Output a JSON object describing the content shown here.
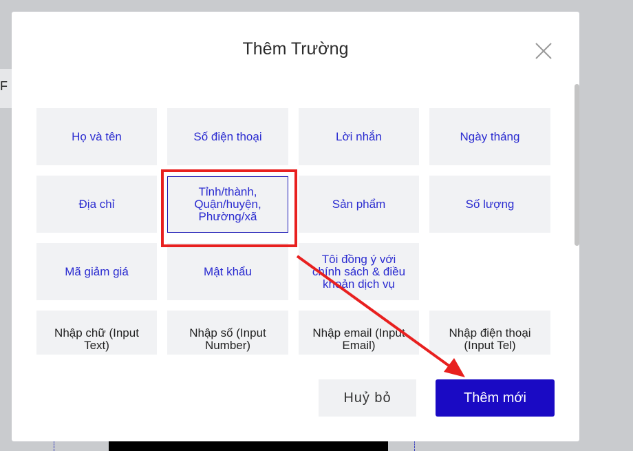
{
  "background": {
    "tab_glyph": "F"
  },
  "modal": {
    "title": "Thêm Trường",
    "close_icon": "close-icon"
  },
  "fields": [
    {
      "label": "Họ và tên",
      "type": "preset"
    },
    {
      "label": "Số điện thoại",
      "type": "preset"
    },
    {
      "label": "Lời nhắn",
      "type": "preset"
    },
    {
      "label": "Ngày tháng",
      "type": "preset"
    },
    {
      "label": "Địa chỉ",
      "type": "preset"
    },
    {
      "label": "Tỉnh/thành, Quận/huyện, Phường/xã",
      "type": "preset",
      "selected": true
    },
    {
      "label": "Sản phẩm",
      "type": "preset"
    },
    {
      "label": "Số lượng",
      "type": "preset"
    },
    {
      "label": "Mã giảm giá",
      "type": "preset"
    },
    {
      "label": "Mật khẩu",
      "type": "preset"
    },
    {
      "label": "Tôi đồng ý với chính sách & điều khoản dịch vụ",
      "type": "preset"
    },
    {
      "label": "Nhập chữ (Input Text)",
      "type": "input"
    },
    {
      "label": "Nhập số (Input Number)",
      "type": "input"
    },
    {
      "label": "Nhập email (Input Email)",
      "type": "input"
    },
    {
      "label": "Nhập điện thoại (Input Tel)",
      "type": "input"
    }
  ],
  "buttons": {
    "cancel": "Huỷ bỏ",
    "add": "Thêm mới"
  },
  "colors": {
    "accent": "#1a0ac4",
    "field_text": "#2a2bd0",
    "annotation": "#e8201f"
  }
}
